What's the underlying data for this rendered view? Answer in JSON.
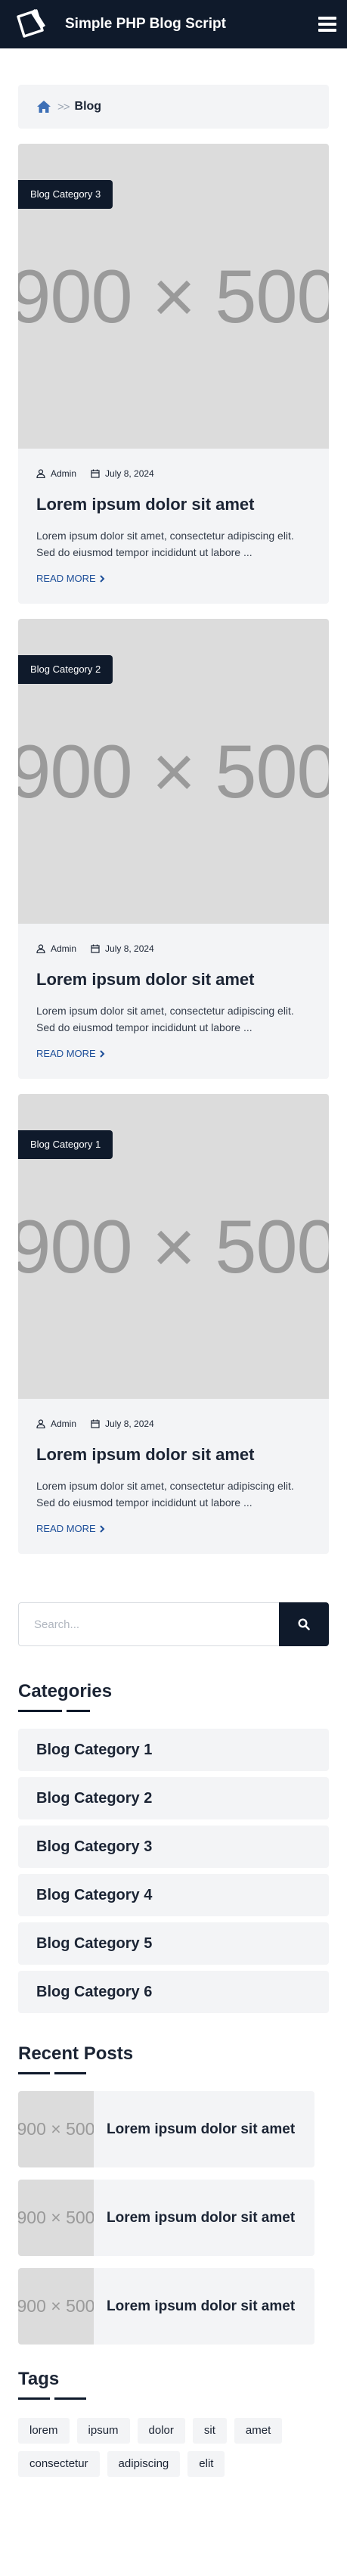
{
  "header": {
    "site_title": "Simple PHP Blog Script"
  },
  "breadcrumb": {
    "separator": ">>",
    "current": "Blog"
  },
  "posts": [
    {
      "category": "Blog Category 3",
      "image_text": "900 × 500",
      "author": "Admin",
      "date": "July 8, 2024",
      "title": "Lorem ipsum dolor sit amet",
      "excerpt": "Lorem ipsum dolor sit amet, consectetur adipiscing elit. Sed do eiusmod tempor incididunt ut labore ...",
      "read_more": "READ MORE"
    },
    {
      "category": "Blog Category 2",
      "image_text": "900 × 500",
      "author": "Admin",
      "date": "July 8, 2024",
      "title": "Lorem ipsum dolor sit amet",
      "excerpt": "Lorem ipsum dolor sit amet, consectetur adipiscing elit. Sed do eiusmod tempor incididunt ut labore ...",
      "read_more": "READ MORE"
    },
    {
      "category": "Blog Category 1",
      "image_text": "900 × 500",
      "author": "Admin",
      "date": "July 8, 2024",
      "title": "Lorem ipsum dolor sit amet",
      "excerpt": "Lorem ipsum dolor sit amet, consectetur adipiscing elit. Sed do eiusmod tempor incididunt ut labore ...",
      "read_more": "READ MORE"
    }
  ],
  "search": {
    "placeholder": "Search..."
  },
  "categories": {
    "title": "Categories",
    "items": [
      "Blog Category 1",
      "Blog Category 2",
      "Blog Category 3",
      "Blog Category 4",
      "Blog Category 5",
      "Blog Category 6"
    ]
  },
  "recent_posts": {
    "title": "Recent Posts",
    "items": [
      {
        "thumb_text": "900 × 500",
        "title": "Lorem ipsum dolor sit amet"
      },
      {
        "thumb_text": "900 × 500",
        "title": "Lorem ipsum dolor sit amet"
      },
      {
        "thumb_text": "900 × 500",
        "title": "Lorem ipsum dolor sit amet"
      }
    ]
  },
  "tags": {
    "title": "Tags",
    "items": [
      "lorem",
      "ipsum",
      "dolor",
      "sit",
      "amet",
      "consectetur",
      "adipiscing",
      "elit"
    ]
  },
  "colors": {
    "header_bg": "#0f1a2b",
    "accent_link": "#1e4f99",
    "panel_bg": "#f3f4f6",
    "placeholder_bg": "#dcdcdc"
  },
  "icons": [
    "logo-icon",
    "menu-icon",
    "home-icon",
    "user-icon",
    "calendar-icon",
    "chevron-right-icon",
    "search-icon"
  ]
}
